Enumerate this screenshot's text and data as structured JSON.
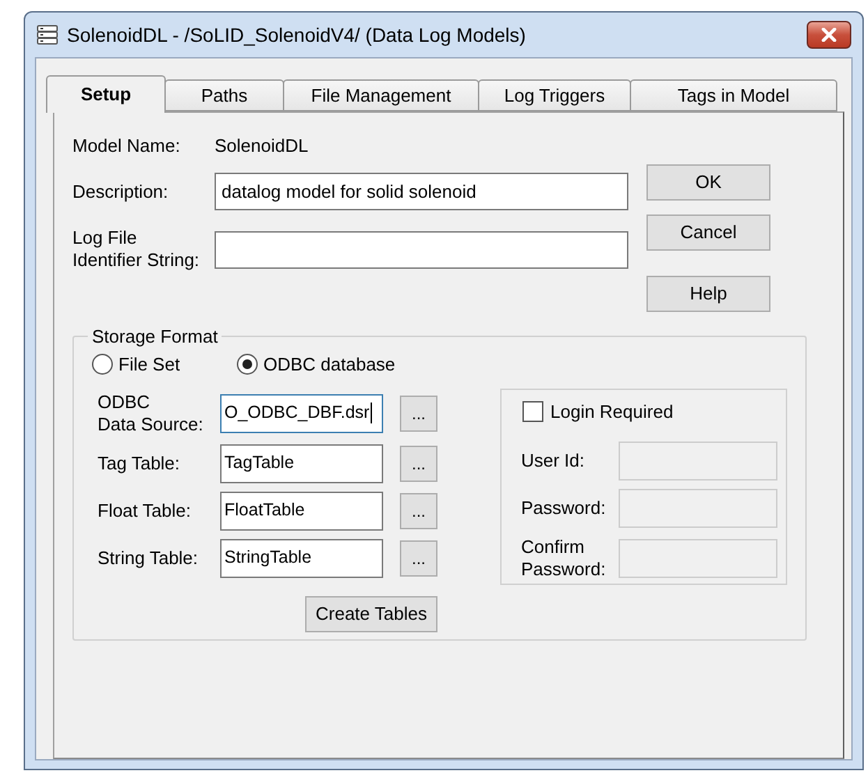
{
  "window": {
    "title": "SolenoidDL - /SoLID_SolenoidV4/ (Data Log Models)"
  },
  "tabs": [
    {
      "label": "Setup",
      "selected": true
    },
    {
      "label": "Paths",
      "selected": false
    },
    {
      "label": "File Management",
      "selected": false
    },
    {
      "label": "Log Triggers",
      "selected": false
    },
    {
      "label": "Tags in Model",
      "selected": false
    }
  ],
  "model_name": {
    "label": "Model Name:",
    "value": "SolenoidDL"
  },
  "fields": [
    {
      "label": "Description:",
      "value": "datalog model for solid solenoid"
    },
    {
      "label": "Log File\nIdentifier String:"
    }
  ],
  "buttons": [
    "OK",
    "Cancel",
    "Help"
  ],
  "storage_format": {
    "title": "Storage Format",
    "options": [
      {
        "label": "File Set",
        "selected": false
      },
      {
        "label": "ODBC database",
        "selected": true
      }
    ],
    "tables": [
      {
        "label": "ODBC\nData Source:",
        "value": "O_ODBC_DBF.dsr",
        "focused": true,
        "browse": "..."
      },
      {
        "label": "Tag Table:",
        "value": "TagTable",
        "focused": false,
        "browse": "..."
      },
      {
        "label": "Float Table:",
        "value": "FloatTable",
        "focused": false,
        "browse": "..."
      },
      {
        "label": "String Table:",
        "value": "StringTable",
        "focused": false,
        "browse": "..."
      }
    ],
    "create_button": "Create Tables",
    "login": {
      "label": "Login Required",
      "checked": false,
      "fields": [
        {
          "label": "User Id:",
          "disabled": true
        },
        {
          "label": "Password:",
          "disabled": true
        },
        {
          "label": "Confirm\nPassword:",
          "disabled": true
        }
      ]
    }
  }
}
